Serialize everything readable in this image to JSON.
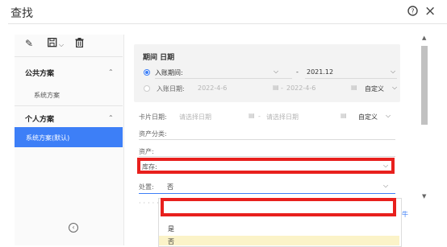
{
  "dialog": {
    "title": "查找"
  },
  "header_icons": [
    "help-icon",
    "close-icon"
  ],
  "sidebar": {
    "toolbar_icons": [
      "edit-icon",
      "save-icon",
      "delete-icon"
    ],
    "sections": [
      {
        "label": "公共方案",
        "items": [
          "系统方案"
        ]
      },
      {
        "label": "个人方案",
        "items": [
          "系统方案(默认)"
        ]
      }
    ]
  },
  "period": {
    "title": "期间 日期",
    "options": [
      {
        "label": "入账期间:",
        "start": "",
        "sep": "-",
        "end": "2021.12",
        "selected": true
      },
      {
        "label": "入账日期:",
        "start": "2022-4-6",
        "sep": "-",
        "end": "2022-4-6",
        "custom": "自定义",
        "selected": false
      }
    ]
  },
  "card_date": {
    "label": "卡片日期:",
    "start_placeholder": "请选择日期",
    "sep": "-",
    "end_placeholder": "请选择日期",
    "custom": "自定义"
  },
  "fields": {
    "asset_category": "资产分类:",
    "asset": "资产:",
    "inventory": "库存:",
    "disposal_label": "处置:",
    "disposal_value": "否"
  },
  "dropdown": {
    "options": [
      "",
      "是",
      "否"
    ],
    "selected_index": 2
  },
  "misc": {
    "partial_right_text": "牛"
  },
  "colors": {
    "accent": "#3d7ff7",
    "highlight": "#e8201d",
    "option_hover": "#fbf3c8"
  }
}
